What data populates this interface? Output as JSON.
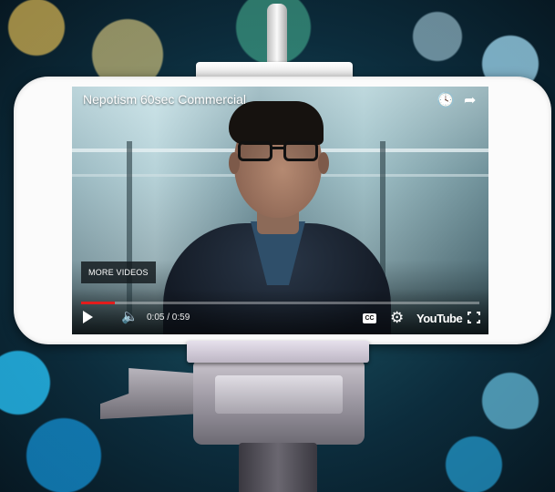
{
  "video": {
    "title": "Nepotism 60sec Commercial",
    "more_videos_label": "MORE VIDEOS",
    "time_display": "0:05 / 0:59",
    "progress_fraction": 0.085,
    "progress_color": "#e31c1c",
    "brand_label": "YouTube",
    "cc_label": "CC"
  },
  "icons": {
    "watch_later": "clock-icon",
    "share": "share-arrow-icon",
    "play": "play-icon",
    "volume": "volume-icon",
    "captions": "closed-captions-icon",
    "settings": "gear-icon",
    "fullscreen": "fullscreen-icon"
  }
}
